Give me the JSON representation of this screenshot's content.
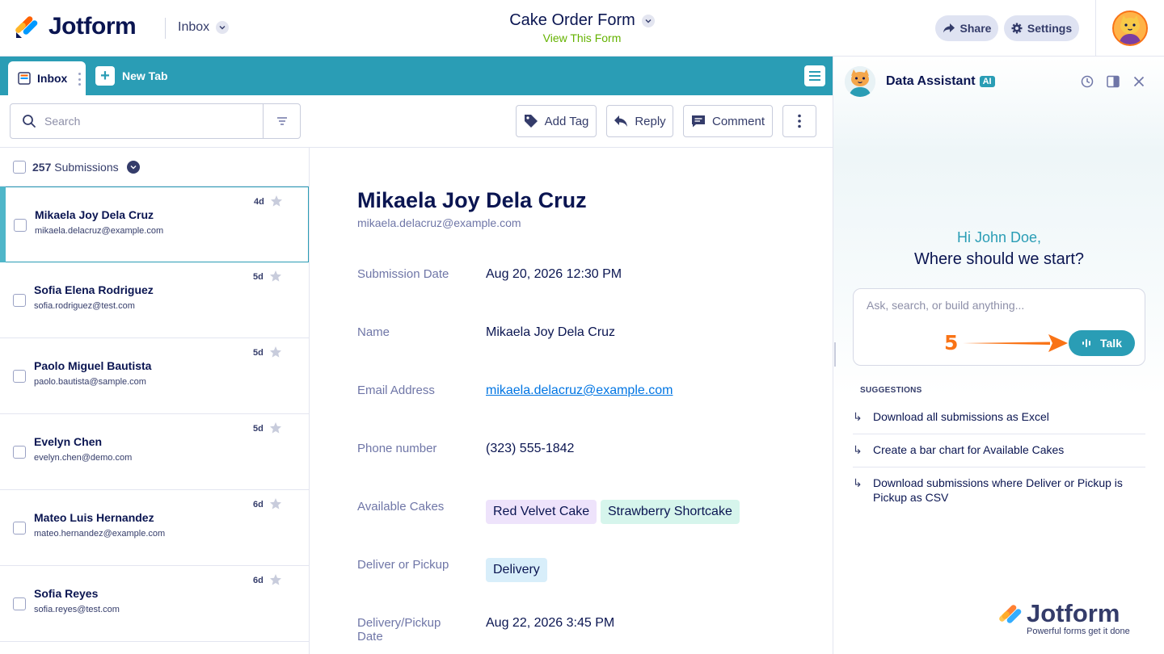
{
  "header": {
    "logo_text": "Jotform",
    "inbox_label": "Inbox",
    "form_title": "Cake Order Form",
    "view_form_link": "View This Form",
    "share_label": "Share",
    "settings_label": "Settings"
  },
  "tabs": {
    "inbox_tab": "Inbox",
    "new_tab": "New Tab"
  },
  "toolbar": {
    "search_placeholder": "Search",
    "add_tag": "Add Tag",
    "reply": "Reply",
    "comment": "Comment"
  },
  "list": {
    "count": "257",
    "count_label": "Submissions",
    "rows": [
      {
        "name": "Mikaela Joy Dela Cruz",
        "email": "mikaela.delacruz@example.com",
        "age": "4d"
      },
      {
        "name": "Sofia Elena Rodriguez",
        "email": "sofia.rodriguez@test.com",
        "age": "5d"
      },
      {
        "name": "Paolo Miguel Bautista",
        "email": "paolo.bautista@sample.com",
        "age": "5d"
      },
      {
        "name": "Evelyn Chen",
        "email": "evelyn.chen@demo.com",
        "age": "5d"
      },
      {
        "name": "Mateo Luis Hernandez",
        "email": "mateo.hernandez@example.com",
        "age": "6d"
      },
      {
        "name": "Sofia Reyes",
        "email": "sofia.reyes@test.com",
        "age": "6d"
      }
    ]
  },
  "detail": {
    "name": "Mikaela Joy Dela Cruz",
    "email": "mikaela.delacruz@example.com",
    "fields": {
      "submission_date_label": "Submission Date",
      "submission_date": "Aug 20, 2026 12:30 PM",
      "name_label": "Name",
      "name": "Mikaela Joy Dela Cruz",
      "email_label": "Email Address",
      "email": "mikaela.delacruz@example.com",
      "phone_label": "Phone number",
      "phone": "(323) 555-1842",
      "cakes_label": "Available Cakes",
      "cakes": [
        "Red Velvet Cake",
        "Strawberry Shortcake"
      ],
      "deliver_label": "Deliver or Pickup",
      "deliver": "Delivery",
      "date_label_1": "Delivery/Pickup",
      "date_label_2": "Date",
      "date": "Aug 22, 2026 3:45 PM"
    }
  },
  "assistant": {
    "title": "Data Assistant",
    "badge": "AI",
    "greeting_1": "Hi John Doe,",
    "greeting_2": "Where should we start?",
    "ask_placeholder": "Ask, search, or build anything...",
    "talk_label": "Talk",
    "step_number": "5",
    "suggestions_heading": "SUGGESTIONS",
    "suggestions": [
      "Download all submissions as Excel",
      "Create a bar chart for Available Cakes",
      "Download submissions where Deliver or Pickup is Pickup as CSV"
    ],
    "watermark_text": "Jotform",
    "watermark_sub": "Powerful forms get it done"
  },
  "colors": {
    "accent": "#2a9db5",
    "navy": "#0a1551",
    "link": "#0075e3",
    "highlight_arrow": "#f97316",
    "tag_purple": "#eee3fb",
    "tag_green": "#d6f5ec",
    "tag_blue": "#d8eefa"
  }
}
